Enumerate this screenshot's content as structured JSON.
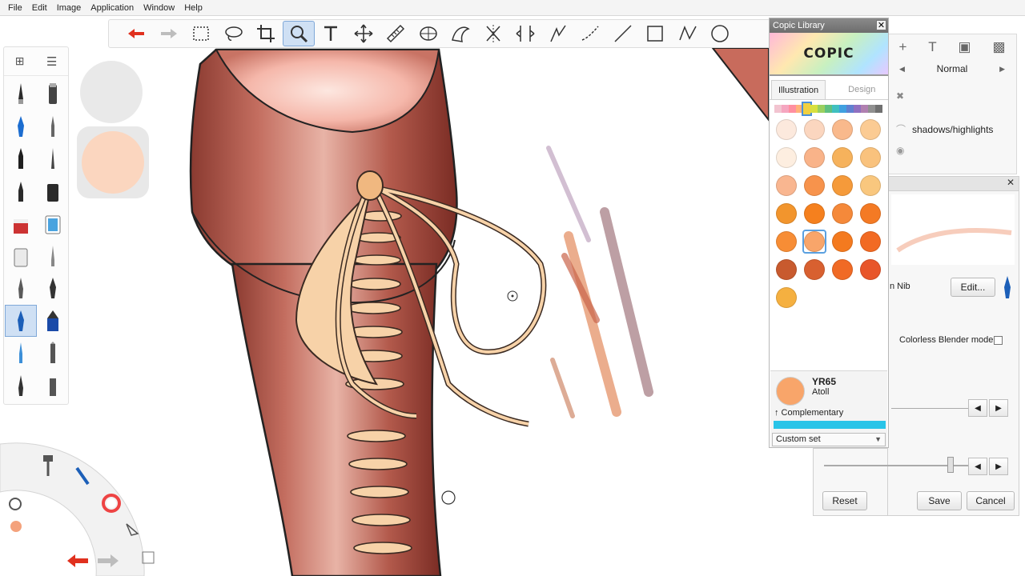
{
  "menu": [
    "File",
    "Edit",
    "Image",
    "Application",
    "Window",
    "Help"
  ],
  "toolbar": {
    "tools": [
      "undo-icon",
      "redo-icon",
      "rect-select-icon",
      "lasso-icon",
      "crop-icon",
      "zoom-icon",
      "text-icon",
      "move-icon",
      "ruler-icon",
      "ellipse-guide-icon",
      "french-curve-icon",
      "symmetry-icon",
      "distort-icon",
      "pen-stroke-icon",
      "curve-icon",
      "line-icon",
      "rectangle-icon",
      "polyline-icon",
      "ellipse-icon"
    ],
    "active_tool": "zoom-icon"
  },
  "copic_library": {
    "title": "Copic Library",
    "logo": "COPIC",
    "tabs": [
      "Illustration",
      "Design"
    ],
    "active_tab": "Illustration",
    "hue_strip": [
      "#f2c4d0",
      "#f5a6c0",
      "#ff8fa0",
      "#ffb27a",
      "#f0d040",
      "#d8e040",
      "#9ad060",
      "#60c080",
      "#40c0c0",
      "#40a0e0",
      "#6080d0",
      "#9070c0",
      "#b080b0",
      "#909090",
      "#707070"
    ],
    "swatches": [
      "#fce9dd",
      "#fbd6bf",
      "#f9b98c",
      "#fbcb93",
      "#fdeee0",
      "#f9b389",
      "#f6b25c",
      "#f9c27d",
      "#f9b690",
      "#f7934c",
      "#f59a3a",
      "#f9c77e",
      "#f2952d",
      "#f5801e",
      "#f5893a",
      "#f47a24",
      "#f78d35",
      "#f8a56a",
      "#f47a1f",
      "#f26a23",
      "#c85a2e",
      "#d86030",
      "#f06a25",
      "#e8552a",
      "#f5b040"
    ],
    "selected_index": 17,
    "selected": {
      "code": "YR65",
      "name": "Atoll",
      "color": "#f8a56a",
      "complementary": "↑ Complementary",
      "bar_color": "#29c4e8"
    },
    "set": "Custom set"
  },
  "layer_panel": {
    "blend_mode": "Normal",
    "layer_name": "shadows/highlights"
  },
  "brush_panel": {
    "nib_label": "n Nib",
    "edit_label": "Edit...",
    "colorless_blender": "Colorless Blender mode",
    "reset": "Reset",
    "save": "Save",
    "cancel": "Cancel"
  },
  "puck": {
    "top_color": "#e9e9e9",
    "bottom_color": "#fbd6bf"
  }
}
